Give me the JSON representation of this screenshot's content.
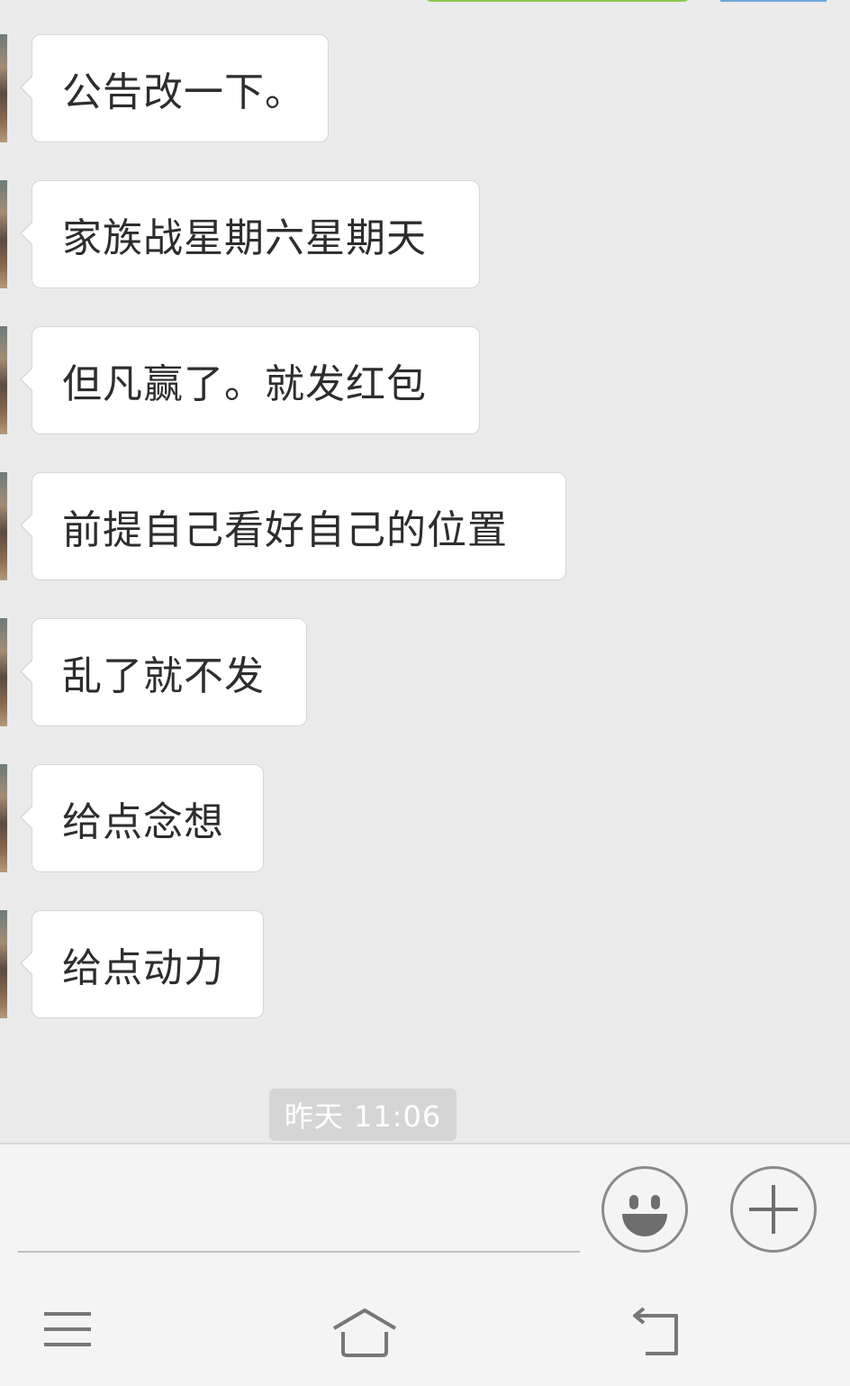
{
  "messages": [
    {
      "text": "公告改一下。"
    },
    {
      "text": "家族战星期六星期天"
    },
    {
      "text": "但凡赢了。就发红包"
    },
    {
      "text": "前提自己看好自己的位置"
    },
    {
      "text": "乱了就不发"
    },
    {
      "text": "给点念想"
    },
    {
      "text": "给点动力"
    }
  ],
  "timestamp": "昨天 11:06",
  "input": {
    "value": "",
    "placeholder": ""
  },
  "icons": {
    "emoji": "smiley-face-icon",
    "plus": "plus-circle-icon",
    "menu": "menu-lines-icon",
    "home": "home-icon",
    "back": "back-arrow-icon"
  },
  "colors": {
    "background": "#ebebeb",
    "bubble": "#ffffff",
    "sent_bubble": "#9fe658",
    "timestamp_bg": "#d5d5d5"
  }
}
